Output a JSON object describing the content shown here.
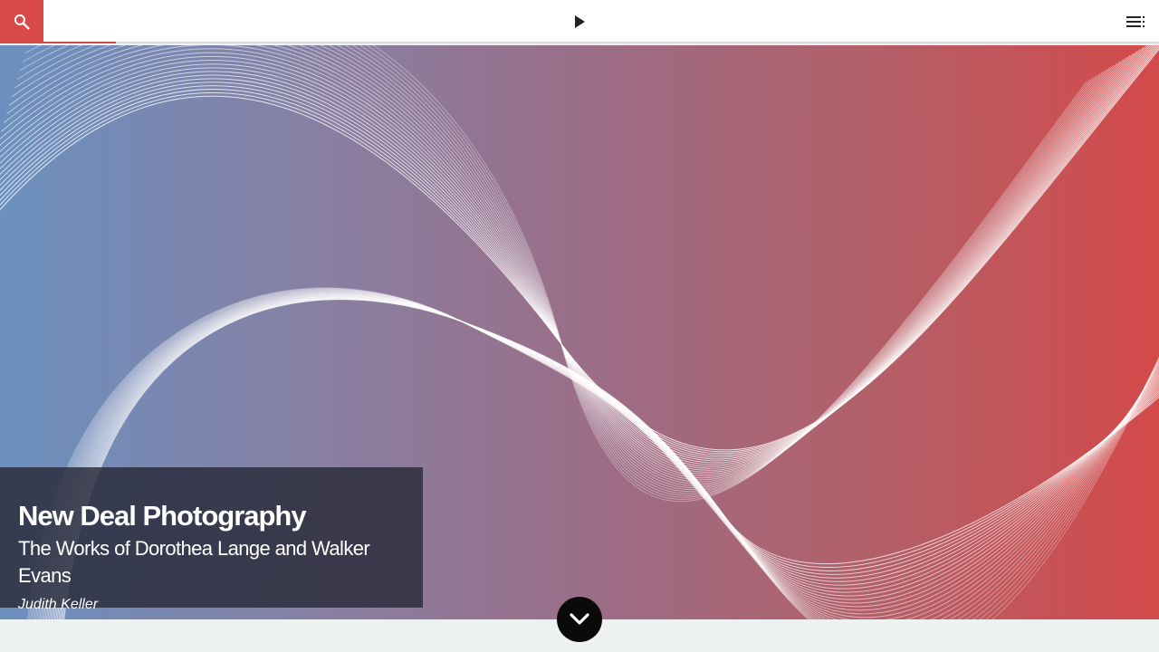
{
  "header": {
    "search_icon": "search-icon",
    "play_icon": "play-icon",
    "toc_icon": "table-of-contents-icon",
    "progress": 0.1
  },
  "hero": {
    "title": "New Deal Photography",
    "subtitle": "The Works of Dorothea Lange and Walker Evans",
    "author": "Judith Keller"
  },
  "scroll_icon": "chevron-down-icon",
  "colors": {
    "accent": "#d84a4a",
    "gradient_left": "#6b90bf",
    "gradient_right": "#d34a4a",
    "card": "#282a38",
    "page_bottom": "#eef1f2"
  }
}
